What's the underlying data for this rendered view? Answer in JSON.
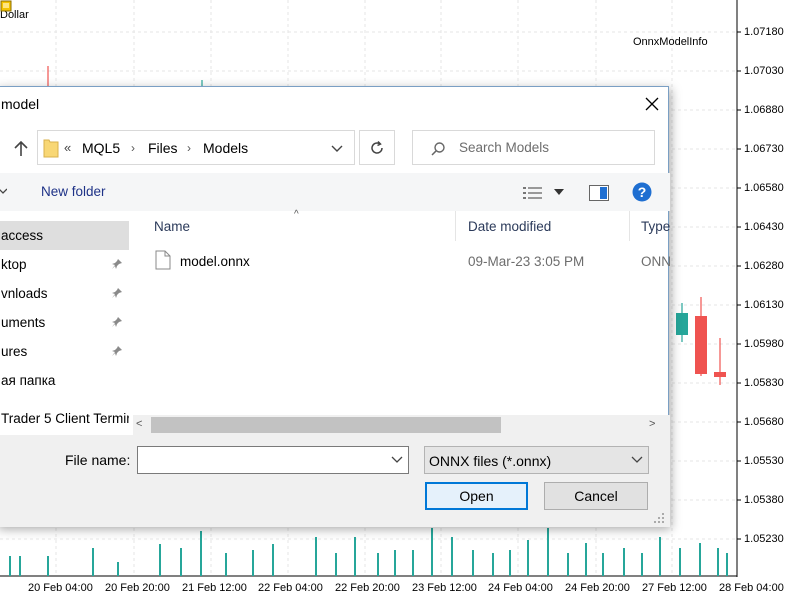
{
  "chart": {
    "title": "Dollar",
    "indicator": "OnnxModelInfo",
    "colors": {
      "bull": "#26a69a",
      "bear": "#ef5350",
      "grid": "#e6e6e6",
      "axis": "#000000"
    },
    "price_labels": [
      "1.07180",
      "1.07030",
      "1.06880",
      "1.06730",
      "1.06580",
      "1.06430",
      "1.06280",
      "1.06130",
      "1.05980",
      "1.05830",
      "1.05680",
      "1.05530",
      "1.05380",
      "1.05230"
    ],
    "date_labels": [
      "20 Feb 04:00",
      "20 Feb 20:00",
      "21 Feb 12:00",
      "22 Feb 04:00",
      "22 Feb 20:00",
      "23 Feb 12:00",
      "24 Feb 04:00",
      "24 Feb 20:00",
      "27 Feb 12:00",
      "28 Feb 04:00"
    ]
  },
  "dialog": {
    "title": "model",
    "breadcrumb": {
      "overflow": "«",
      "parts": [
        "MQL5",
        "Files",
        "Models"
      ]
    },
    "search_placeholder": "Search Models",
    "new_folder_label": "New folder",
    "nav_items": [
      {
        "label": "access",
        "pinned": false,
        "selected": true
      },
      {
        "label": "ktop",
        "pinned": true,
        "selected": false
      },
      {
        "label": "vnloads",
        "pinned": true,
        "selected": false
      },
      {
        "label": "uments",
        "pinned": true,
        "selected": false
      },
      {
        "label": "ures",
        "pinned": true,
        "selected": false
      },
      {
        "label": "ая папка",
        "pinned": false,
        "selected": false
      },
      {
        "label": "Trader 5 Client Termir",
        "pinned": false,
        "selected": false
      }
    ],
    "columns": {
      "name": "Name",
      "date": "Date modified",
      "type": "Type"
    },
    "files": [
      {
        "name": "model.onnx",
        "date": "09-Mar-23 3:05 PM",
        "type": "ONN"
      }
    ],
    "filename_label": "File name:",
    "filename_value": "",
    "filetype_value": "ONNX files (*.onnx)",
    "open_label": "Open",
    "cancel_label": "Cancel"
  }
}
